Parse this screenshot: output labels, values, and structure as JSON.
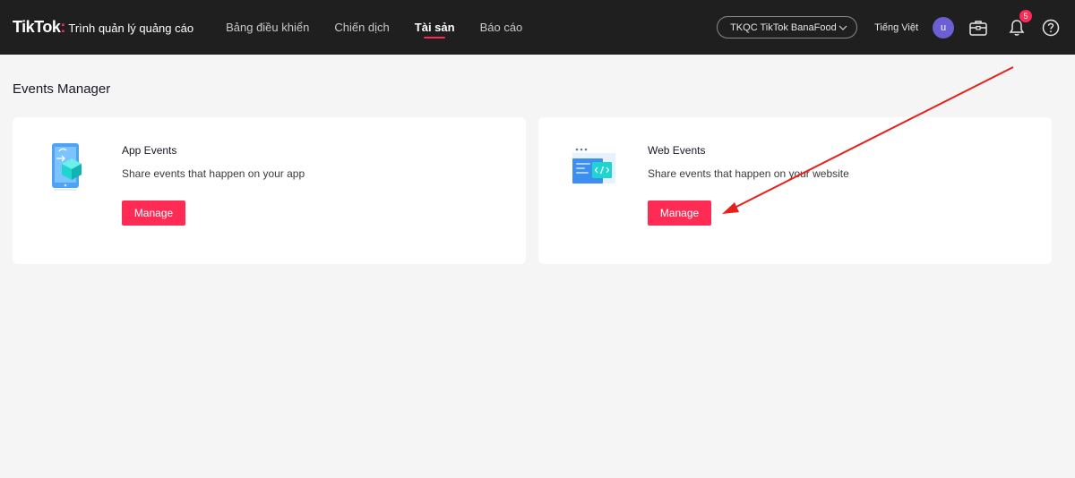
{
  "header": {
    "brand_logo": "TikTok",
    "brand_colon": ":",
    "brand_sub": "Trình quản lý quảng cáo",
    "nav": [
      {
        "label": "Bảng điều khiển",
        "active": false
      },
      {
        "label": "Chiến dịch",
        "active": false
      },
      {
        "label": "Tài sản",
        "active": true
      },
      {
        "label": "Báo cáo",
        "active": false
      }
    ],
    "account": "TKQC TikTok BanaFood",
    "language": "Tiếng Việt",
    "avatar_initial": "u",
    "notifications_count": "5"
  },
  "page": {
    "title": "Events Manager"
  },
  "cards": {
    "app": {
      "title": "App Events",
      "description": "Share events that happen on your app",
      "button": "Manage"
    },
    "web": {
      "title": "Web Events",
      "description": "Share events that happen on your website",
      "button": "Manage"
    }
  },
  "colors": {
    "accent": "#fe2c55",
    "topbar": "#1f1f1f",
    "background": "#f5f5f5",
    "annotation_arrow": "#e8201c"
  }
}
